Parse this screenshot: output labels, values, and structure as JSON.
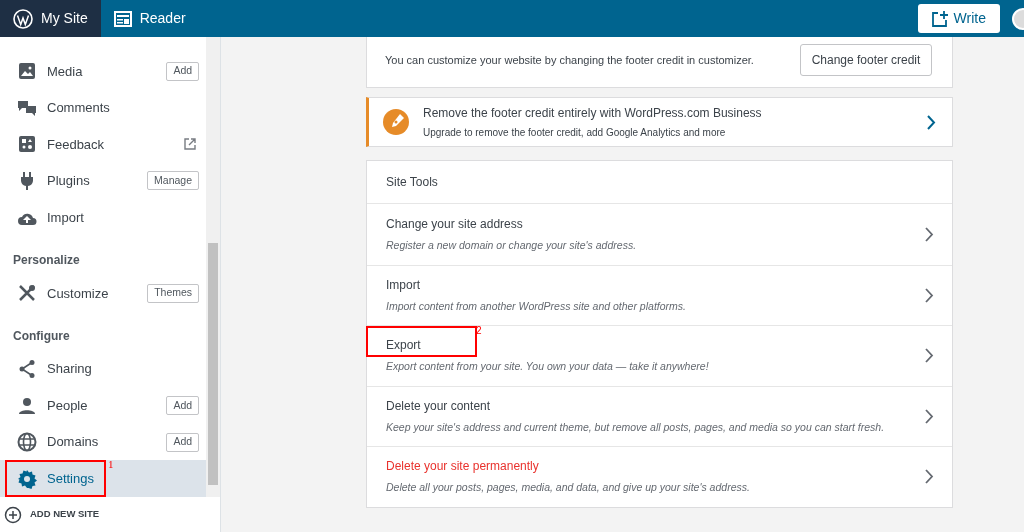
{
  "masterbar": {
    "tabs": [
      {
        "label": "My Site",
        "selected": true
      },
      {
        "label": "Reader",
        "selected": false
      }
    ],
    "write_button": "Write"
  },
  "sidebar": {
    "groups": [
      {
        "items": [
          {
            "label": "Media",
            "action": "Add",
            "selected": false
          },
          {
            "label": "Comments",
            "selected": false
          },
          {
            "label": "Feedback",
            "external": true,
            "selected": false
          },
          {
            "label": "Plugins",
            "action": "Manage",
            "selected": false
          },
          {
            "label": "Import",
            "selected": false
          }
        ]
      },
      {
        "heading": "Personalize",
        "items": [
          {
            "label": "Customize",
            "action": "Themes",
            "selected": false
          }
        ]
      },
      {
        "heading": "Configure",
        "items": [
          {
            "label": "Sharing",
            "selected": false
          },
          {
            "label": "People",
            "action": "Add",
            "selected": false
          },
          {
            "label": "Domains",
            "action": "Add",
            "selected": false
          },
          {
            "label": "Settings",
            "selected": true,
            "annotation": "1"
          }
        ]
      }
    ],
    "add_new_site": "ADD NEW SITE"
  },
  "footer_card": {
    "text": "You can customize your website by changing the footer credit in customizer.",
    "button": "Change footer credit"
  },
  "upsell": {
    "title": "Remove the footer credit entirely with WordPress.com Business",
    "subtitle": "Upgrade to remove the footer credit, add Google Analytics and more"
  },
  "site_tools": {
    "heading": "Site Tools",
    "rows": [
      {
        "title": "Change your site address",
        "description": "Register a new domain or change your site's address.",
        "danger": false
      },
      {
        "title": "Import",
        "description": "Import content from another WordPress site and other platforms.",
        "danger": false
      },
      {
        "title": "Export",
        "description": "Export content from your site. You own your data — take it anywhere!",
        "danger": false,
        "annotation": "2"
      },
      {
        "title": "Delete your content",
        "description": "Keep your site's address and current theme, but remove all posts, pages, and media so you can start fresh.",
        "danger": false
      },
      {
        "title": "Delete your site permanently",
        "description": "Delete all your posts, pages, media, and data, and give up your site's address.",
        "danger": true
      }
    ]
  }
}
